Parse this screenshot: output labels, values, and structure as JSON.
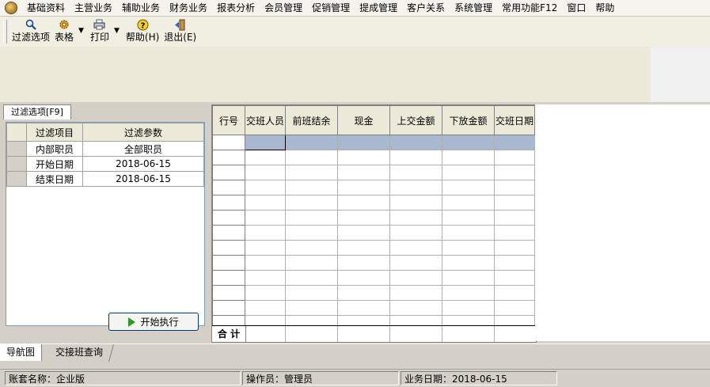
{
  "menu": [
    "基础资料",
    "主营业务",
    "辅助业务",
    "财务业务",
    "报表分析",
    "会员管理",
    "促销管理",
    "提成管理",
    "客户关系",
    "系统管理",
    "常用功能F12",
    "窗口",
    "帮助"
  ],
  "toolbar": {
    "filter_label": "过滤选项",
    "table_label": "表格",
    "print_label": "打印",
    "help_label": "帮助(H)",
    "exit_label": "退出(E)"
  },
  "filter_tab": "过滤选项[F9]",
  "filter_table": {
    "headers": [
      "过滤项目",
      "过滤参数"
    ],
    "rows": [
      {
        "item": "内部职员",
        "value": "全部职员"
      },
      {
        "item": "开始日期",
        "value": "2018-06-15"
      },
      {
        "item": "结束日期",
        "value": "2018-06-15"
      }
    ]
  },
  "run_button": "开始执行",
  "grid": {
    "columns": [
      "行号",
      "交班人员",
      "前班结余",
      "现金",
      "上交金额",
      "下放金额",
      "交班日期"
    ],
    "sum_label": "合 计"
  },
  "nav_tabs": [
    "导航图",
    "交接班查询"
  ],
  "status": {
    "account": "账套名称：企业版",
    "operator": "操作员：管理员",
    "date": "业务日期：2018-06-15"
  },
  "colors": {
    "selected_row": "#a8b8d0",
    "play_icon": "#2a9a2a"
  }
}
